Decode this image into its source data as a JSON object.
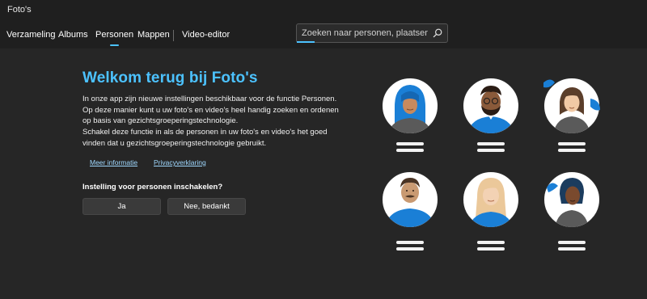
{
  "app": {
    "title": "Foto's"
  },
  "nav": {
    "tabs": [
      {
        "label": "Verzameling"
      },
      {
        "label": "Albums"
      },
      {
        "label": "Personen",
        "active": true
      },
      {
        "label": "Mappen"
      },
      {
        "label": "Video-editor"
      }
    ]
  },
  "search": {
    "placeholder": "Zoeken naar personen, plaatsen of dir",
    "icon": "search-icon"
  },
  "welcome": {
    "title": "Welkom terug bij Foto's",
    "paragraph1": "In onze app zijn nieuwe instellingen beschikbaar voor de functie Personen. Op deze manier kunt u uw foto's en video's heel handig zoeken en ordenen op basis van gezichtsgroeperingstechnologie.",
    "paragraph2": "Schakel deze functie in als de personen in uw foto's en video's het goed vinden dat u gezichtsgroeperingstechnologie gebruikt.",
    "links": {
      "more_info": "Meer informatie",
      "privacy": "Privacyverklaring"
    },
    "question": "Instelling voor personen inschakelen?",
    "buttons": {
      "yes": "Ja",
      "no": "Nee, bedankt"
    }
  },
  "colors": {
    "accent": "#4cc2ff",
    "title_blue": "#4cc2ff",
    "background": "#262626",
    "chrome": "#1f1f1f"
  }
}
